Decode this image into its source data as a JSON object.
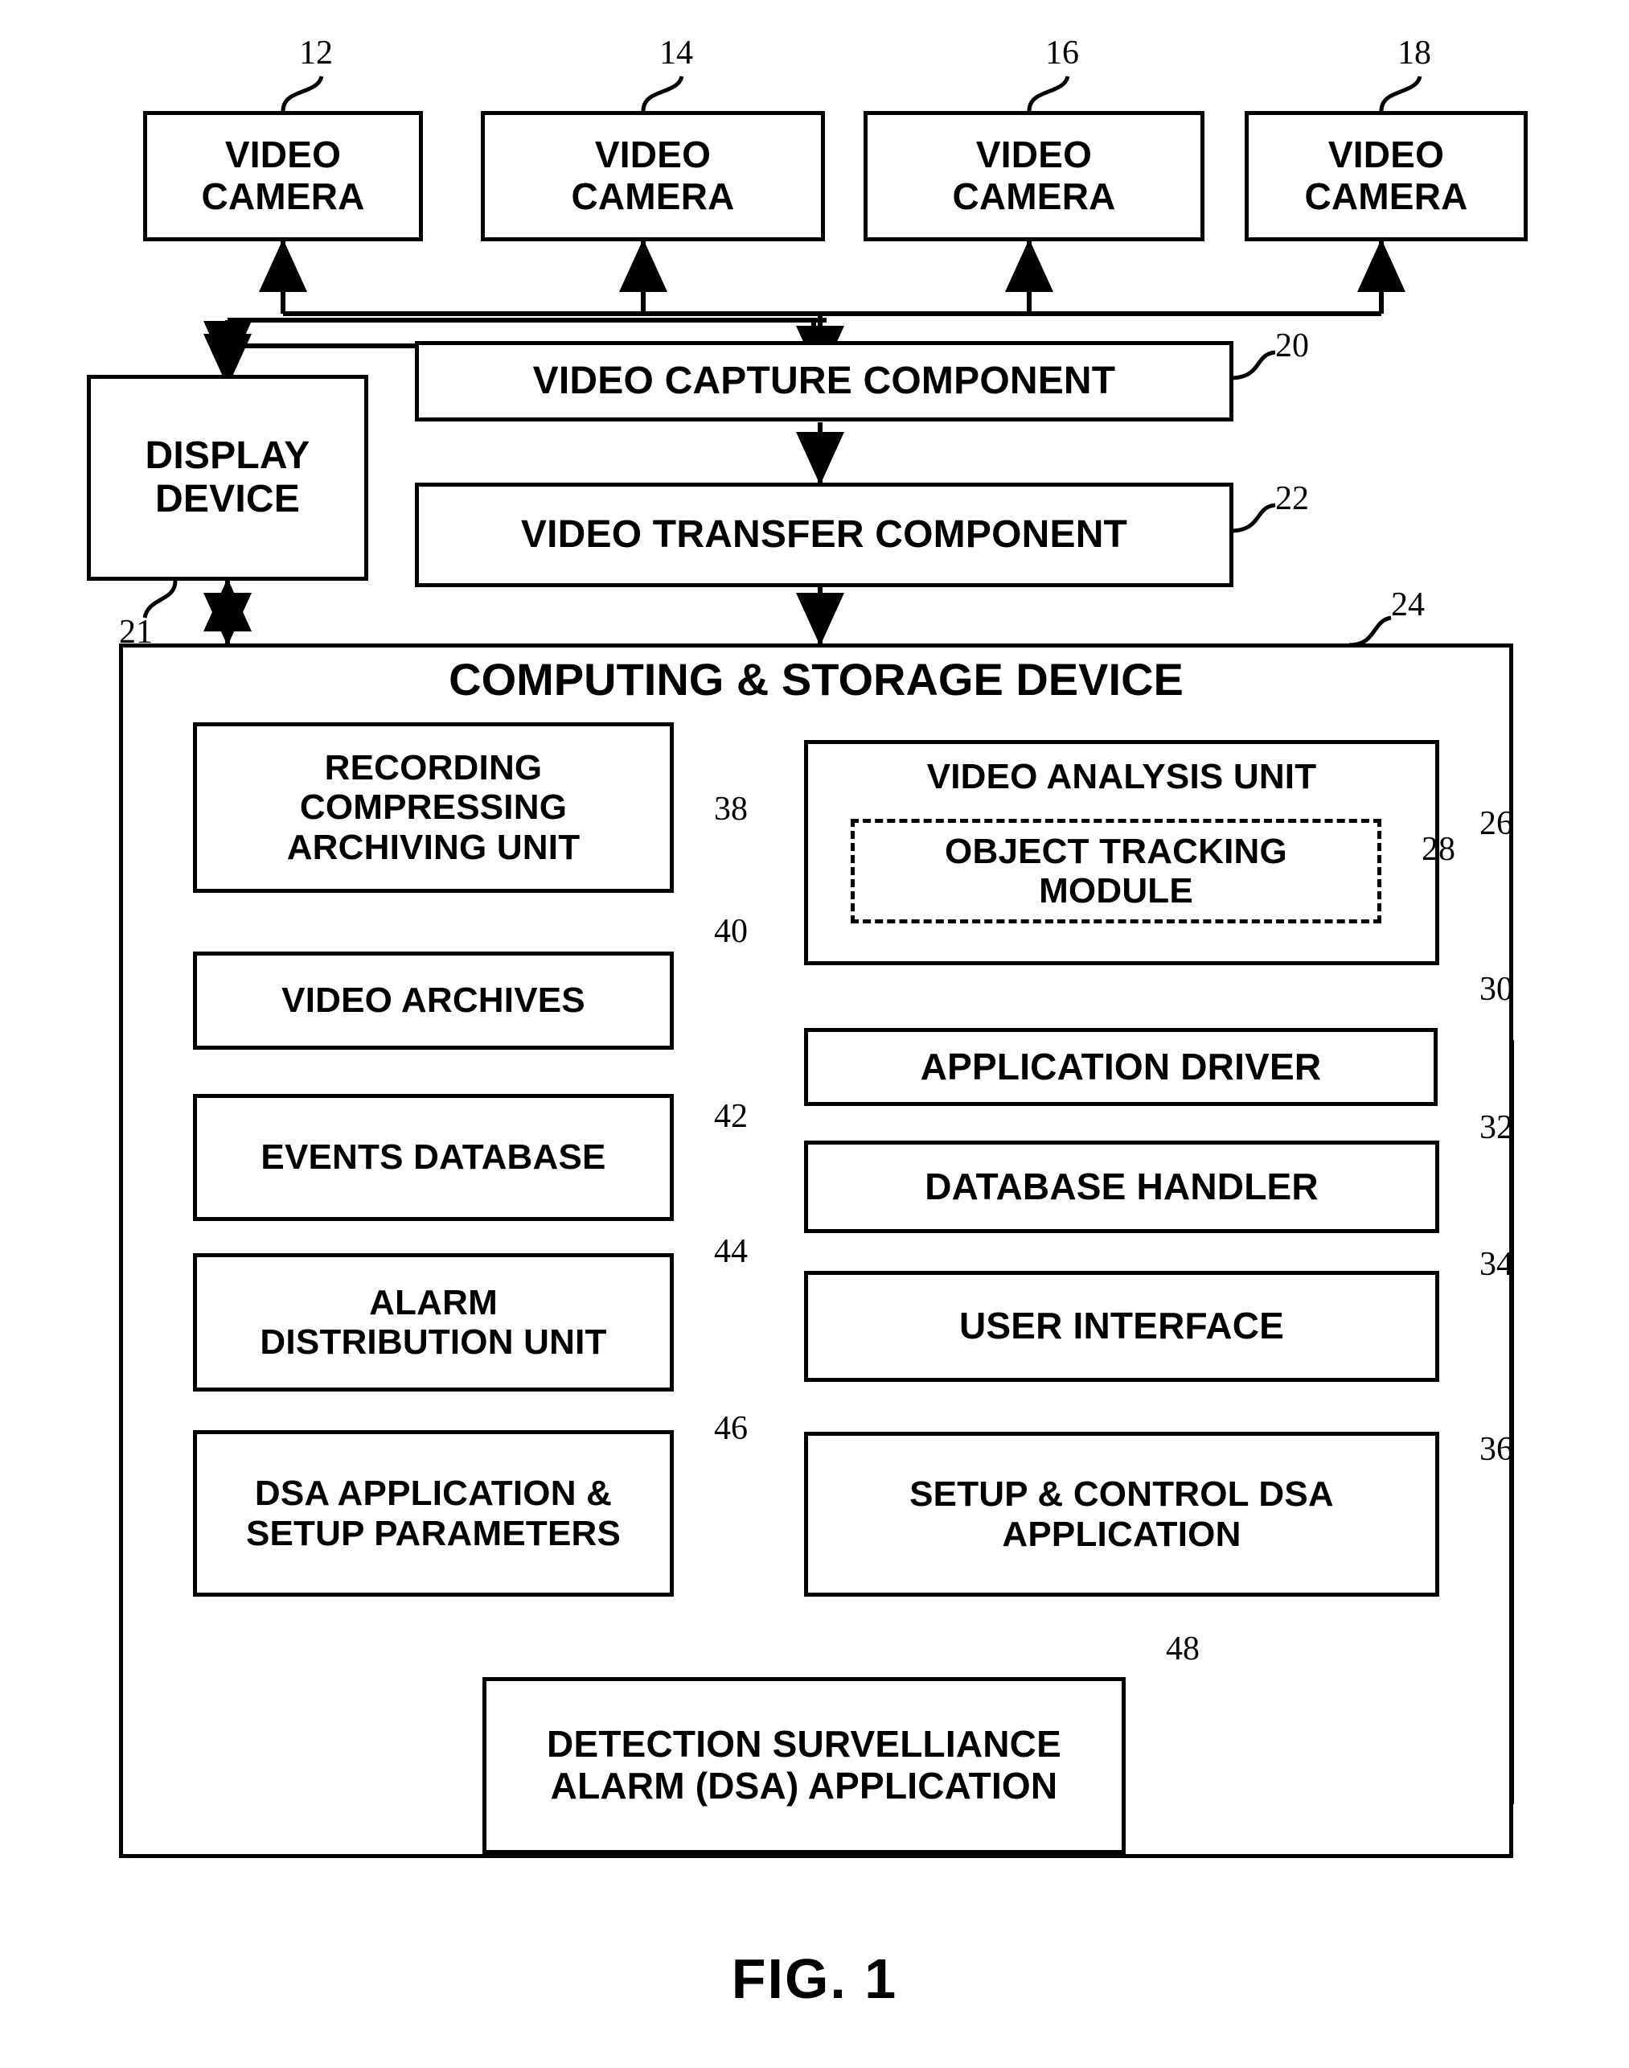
{
  "figure": {
    "caption": "FIG. 1",
    "title": "Video surveillance system block diagram"
  },
  "cameras": [
    {
      "label": "VIDEO\nCAMERA",
      "line1": "VIDEO",
      "line2": "CAMERA",
      "ref": "12"
    },
    {
      "label": "VIDEO\nCAMERA",
      "line1": "VIDEO",
      "line2": "CAMERA",
      "ref": "14"
    },
    {
      "label": "VIDEO\nCAMERA",
      "line1": "VIDEO",
      "line2": "CAMERA",
      "ref": "16"
    },
    {
      "label": "VIDEO\nCAMERA",
      "line1": "VIDEO",
      "line2": "CAMERA",
      "ref": "18"
    }
  ],
  "display_device": {
    "line1": "DISPLAY",
    "line2": "DEVICE",
    "ref": "21"
  },
  "capture": {
    "label": "VIDEO CAPTURE COMPONENT",
    "ref": "20"
  },
  "transfer": {
    "label": "VIDEO TRANSFER COMPONENT",
    "ref": "22"
  },
  "computing_storage_device": {
    "title": "COMPUTING & STORAGE DEVICE",
    "ref": "24"
  },
  "left_column": [
    {
      "name": "recording-compressing-archiving-unit",
      "line1": "RECORDING",
      "line2": "COMPRESSING",
      "line3": "ARCHIVING UNIT",
      "ref": "38"
    },
    {
      "name": "video-archives",
      "line1": "VIDEO ARCHIVES",
      "ref": "40"
    },
    {
      "name": "events-database",
      "line1": "EVENTS DATABASE",
      "ref": "42"
    },
    {
      "name": "alarm-distribution-unit",
      "line1": "ALARM",
      "line2": "DISTRIBUTION UNIT",
      "ref": "44"
    },
    {
      "name": "dsa-application-setup-parameters",
      "line1": "DSA APPLICATION &",
      "line2": "SETUP PARAMETERS",
      "ref": "46"
    }
  ],
  "right_column": [
    {
      "name": "video-analysis-unit",
      "line1": "VIDEO ANALYSIS UNIT",
      "ref": "26"
    },
    {
      "name": "object-tracking-module",
      "line1": "OBJECT TRACKING",
      "line2": "MODULE",
      "ref": "28"
    },
    {
      "name": "application-driver",
      "line1": "APPLICATION DRIVER",
      "ref": "30"
    },
    {
      "name": "database-handler",
      "line1": "DATABASE HANDLER",
      "ref": "32"
    },
    {
      "name": "user-interface",
      "line1": "USER INTERFACE",
      "ref": "34"
    },
    {
      "name": "setup-control-dsa-application",
      "line1": "SETUP & CONTROL  DSA",
      "line2": "APPLICATION",
      "ref": "36"
    }
  ],
  "dsa_application": {
    "line1": "DETECTION SURVELLIANCE",
    "line2": "ALARM (DSA) APPLICATION",
    "ref": "48"
  }
}
